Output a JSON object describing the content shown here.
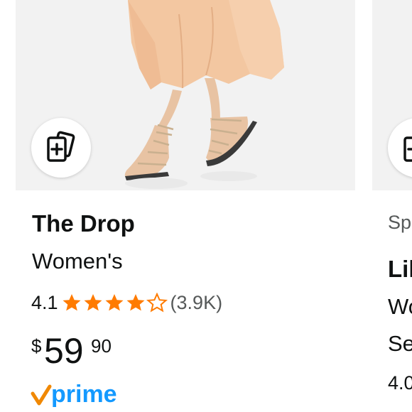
{
  "product_cards": [
    {
      "brand": "The Drop",
      "subtitle": "Women's",
      "rating": "4.1",
      "stars_filled": 4,
      "stars_total": 5,
      "review_count": "(3.9K)",
      "price": {
        "symbol": "$",
        "whole": "59",
        "fraction": "90"
      },
      "badge": "prime",
      "compare_icon": "compare-cards-icon"
    },
    {
      "sponsored": "Spo",
      "brand": "Lil",
      "line2": "Wo",
      "line3": "Se",
      "rating": "4.0"
    }
  ],
  "colors": {
    "star": "#ff7b00",
    "prime_check": "#f08804",
    "prime_text": "#1399ff",
    "text": "#0f1111",
    "muted": "#565959",
    "image_bg": "#f2f2f2"
  }
}
